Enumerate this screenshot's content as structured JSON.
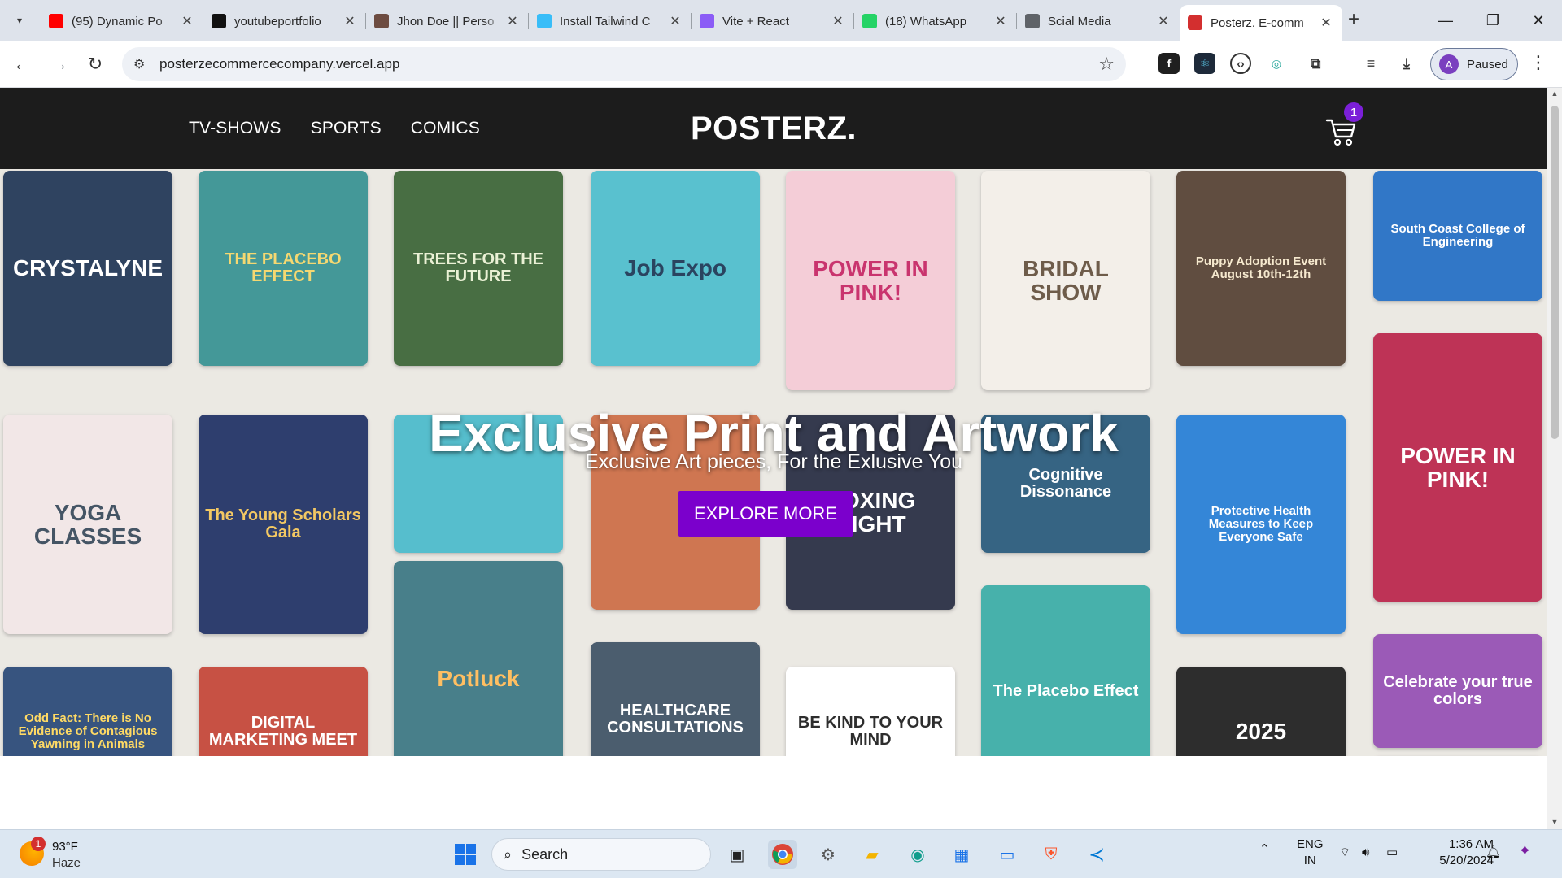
{
  "browser": {
    "tabs": [
      {
        "label": "(95) Dynamic Po",
        "favicon": "youtube-icon",
        "color": "#ff0000"
      },
      {
        "label": "youtubeportfolio",
        "favicon": "github-icon",
        "color": "#111111"
      },
      {
        "label": "Jhon Doe || Perso",
        "favicon": "avatar-icon",
        "color": "#6d4c41"
      },
      {
        "label": "Install Tailwind C",
        "favicon": "tailwind-icon",
        "color": "#38bdf8"
      },
      {
        "label": "Vite + React",
        "favicon": "vite-icon",
        "color": "#8b5cf6"
      },
      {
        "label": "(18) WhatsApp",
        "favicon": "whatsapp-icon",
        "color": "#25d366"
      },
      {
        "label": "Scial Media",
        "favicon": "globe-icon",
        "color": "#5f6368"
      },
      {
        "label": "Posterz. E-comm",
        "favicon": "cart-favicon",
        "color": "#d32f2f",
        "active": true
      }
    ],
    "url": "posterzecommercecompany.vercel.app",
    "profile_label": "Paused",
    "profile_initial": "A"
  },
  "site": {
    "nav": [
      "TV-SHOWS",
      "SPORTS",
      "COMICS"
    ],
    "brand": "POSTERZ.",
    "cart_count": "1",
    "hero": {
      "title": "Exclusive Print and Artwork",
      "subtitle": "Exclusive Art pieces, For the Exlusive You",
      "button": "EXPLORE MORE"
    },
    "posters": [
      {
        "text": "CRYSTALYNE",
        "bg": "#13294b",
        "fg": "#ffffff"
      },
      {
        "text": "THE PLACEBO EFFECT",
        "bg": "#2b8a8a",
        "fg": "#f4d35e"
      },
      {
        "text": "TREES FOR THE FUTURE",
        "bg": "#2f5a2a",
        "fg": "#e8f0d0"
      },
      {
        "text": "Job Expo",
        "bg": "#43b9c9",
        "fg": "#0d2b4a"
      },
      {
        "text": "POWER IN PINK!",
        "bg": "#f3c6d2",
        "fg": "#c2185b"
      },
      {
        "text": "BRIDAL SHOW",
        "bg": "#f2ede6",
        "fg": "#5a4632"
      },
      {
        "text": "Puppy Adoption Event August 10th-12th",
        "bg": "#4a3526",
        "fg": "#f5e6c8"
      },
      {
        "text": "South Coast College of Engineering",
        "bg": "#1565c0",
        "fg": "#ffffff"
      },
      {
        "text": "YOGA CLASSES",
        "bg": "#f1e4e4",
        "fg": "#2c3e50"
      },
      {
        "text": "The Young Scholars Gala",
        "bg": "#12245a",
        "fg": "#f2c14e"
      },
      {
        "text": "",
        "bg": "#3fb6c6",
        "fg": "#0d2b4a"
      },
      {
        "text": "",
        "bg": "#c9643a",
        "fg": "#ffffff"
      },
      {
        "text": "BOXING NIGHT",
        "bg": "#1a1f36",
        "fg": "#ffffff"
      },
      {
        "text": "Cognitive Dissonance",
        "bg": "#1b4f72",
        "fg": "#ffffff"
      },
      {
        "text": "Protective Health Measures to Keep Everyone Safe",
        "bg": "#1976d2",
        "fg": "#ffffff"
      },
      {
        "text": "POWER IN PINK!",
        "bg": "#b5173f",
        "fg": "#ffffff"
      },
      {
        "text": "Odd Fact: There is No Evidence of Contagious Yawning in Animals",
        "bg": "#1c3d6e",
        "fg": "#ffd54f"
      },
      {
        "text": "DIGITAL MARKETING MEET",
        "bg": "#c0392b",
        "fg": "#ffffff"
      },
      {
        "text": "Potluck",
        "bg": "#2f6e7a",
        "fg": "#ffb74d"
      },
      {
        "text": "HEALTHCARE CONSULTATIONS",
        "bg": "#33475b",
        "fg": "#ffffff"
      },
      {
        "text": "BE KIND TO YOUR MIND",
        "bg": "#ffffff",
        "fg": "#111111"
      },
      {
        "text": "The Placebo Effect",
        "bg": "#2ea7a0",
        "fg": "#ffffff"
      },
      {
        "text": "2025",
        "bg": "#111111",
        "fg": "#ffffff"
      },
      {
        "text": "Celebrate your true colors",
        "bg": "#8e44ad",
        "fg": "#ffffff"
      },
      {
        "text": "",
        "bg": "#c76d1c",
        "fg": "#ffffff"
      }
    ]
  },
  "taskbar": {
    "weather_temp": "93°F",
    "weather_desc": "Haze",
    "weather_badge": "1",
    "search_label": "Search",
    "lang": "ENG",
    "region": "IN",
    "time": "1:36 AM",
    "date": "5/20/2024"
  }
}
